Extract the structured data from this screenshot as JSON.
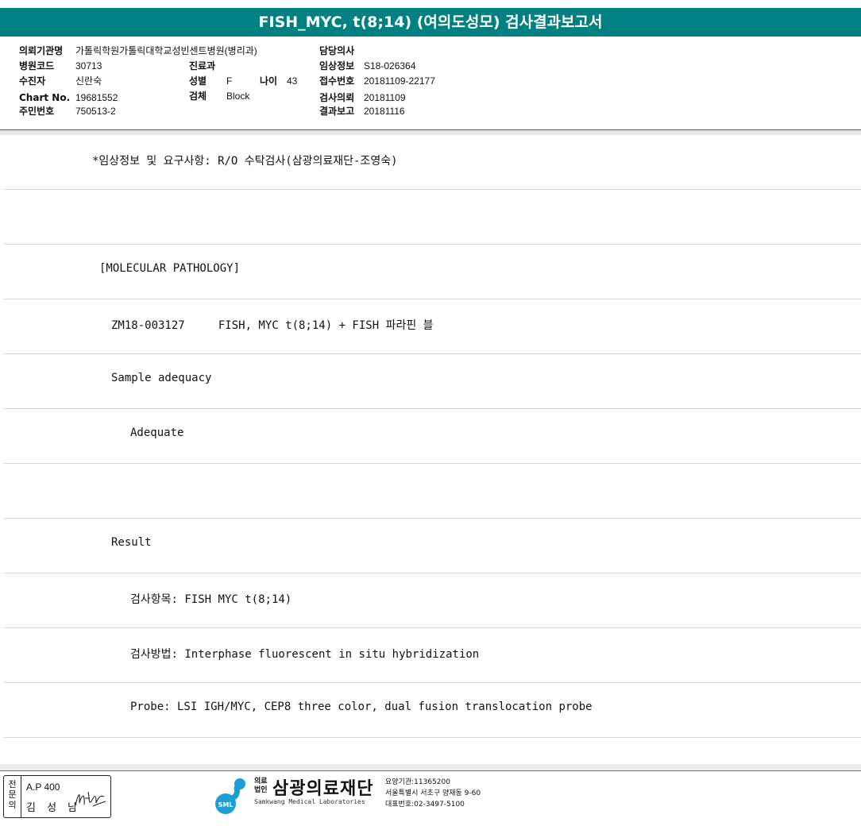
{
  "report": {
    "title": "FISH_MYC, t(8;14) (여의도성모) 검사결과보고서"
  },
  "header": {
    "institution_label": "의뢰기관명",
    "institution_value": "가톨릭학원가톨릭대학교성빈센트병원(병리과)",
    "hospital_code_label": "병원코드",
    "hospital_code_value": "30713",
    "department_label": "진료과",
    "department_value": "",
    "patient_label": "수진자",
    "patient_value": "신란숙",
    "sex_label": "성별",
    "sex_value": "F",
    "age_label": "나이",
    "age_value": "43",
    "chart_no_label": "Chart No.",
    "chart_no_value": "19681552",
    "specimen_label": "검체",
    "specimen_value": "Block",
    "resident_no_label": "주민번호",
    "resident_no_value": "750513-2",
    "physician_label": "담당의사",
    "physician_value": "",
    "clinical_info_label": "임상정보",
    "clinical_info_value": "S18-026364",
    "reception_no_label": "접수번호",
    "reception_no_value": "20181109-22177",
    "test_request_label": "검사의뢰",
    "test_request_value": "20181109",
    "result_report_label": "결과보고",
    "result_report_value": "20181116"
  },
  "body_lines": [
    "*임상정보 및 요구사항: R/O 수탁검사(삼광의료재단-조영숙)",
    "",
    "[MOLECULAR PATHOLOGY]",
    "ZM18-003127     FISH, MYC t(8;14) + FISH 파라핀 블",
    "Sample adequacy",
    "Adequate",
    "",
    "Result",
    "검사항목: FISH MYC t(8;14)",
    "검사방법: Interphase fluorescent in situ hybridization",
    "Probe: LSI IGH/MYC, CEP8 three color, dual fusion translocation probe"
  ],
  "footer": {
    "specialist_vertical": "전문의",
    "ap_code": "A.P 400",
    "doctor_name": "김 성 남",
    "org_type": "의료법인",
    "org_name": "삼광의료재단",
    "org_english": "Samkwang Medical Laboratories",
    "logo_text": "SML",
    "institution_code": "요양기관:11365200",
    "address": "서울특별시 서초구 양재동 9-60",
    "phone": "대표번호:02-3497-5100"
  },
  "colors": {
    "title_bar": "#008080",
    "logo": "#1a9fd6"
  }
}
